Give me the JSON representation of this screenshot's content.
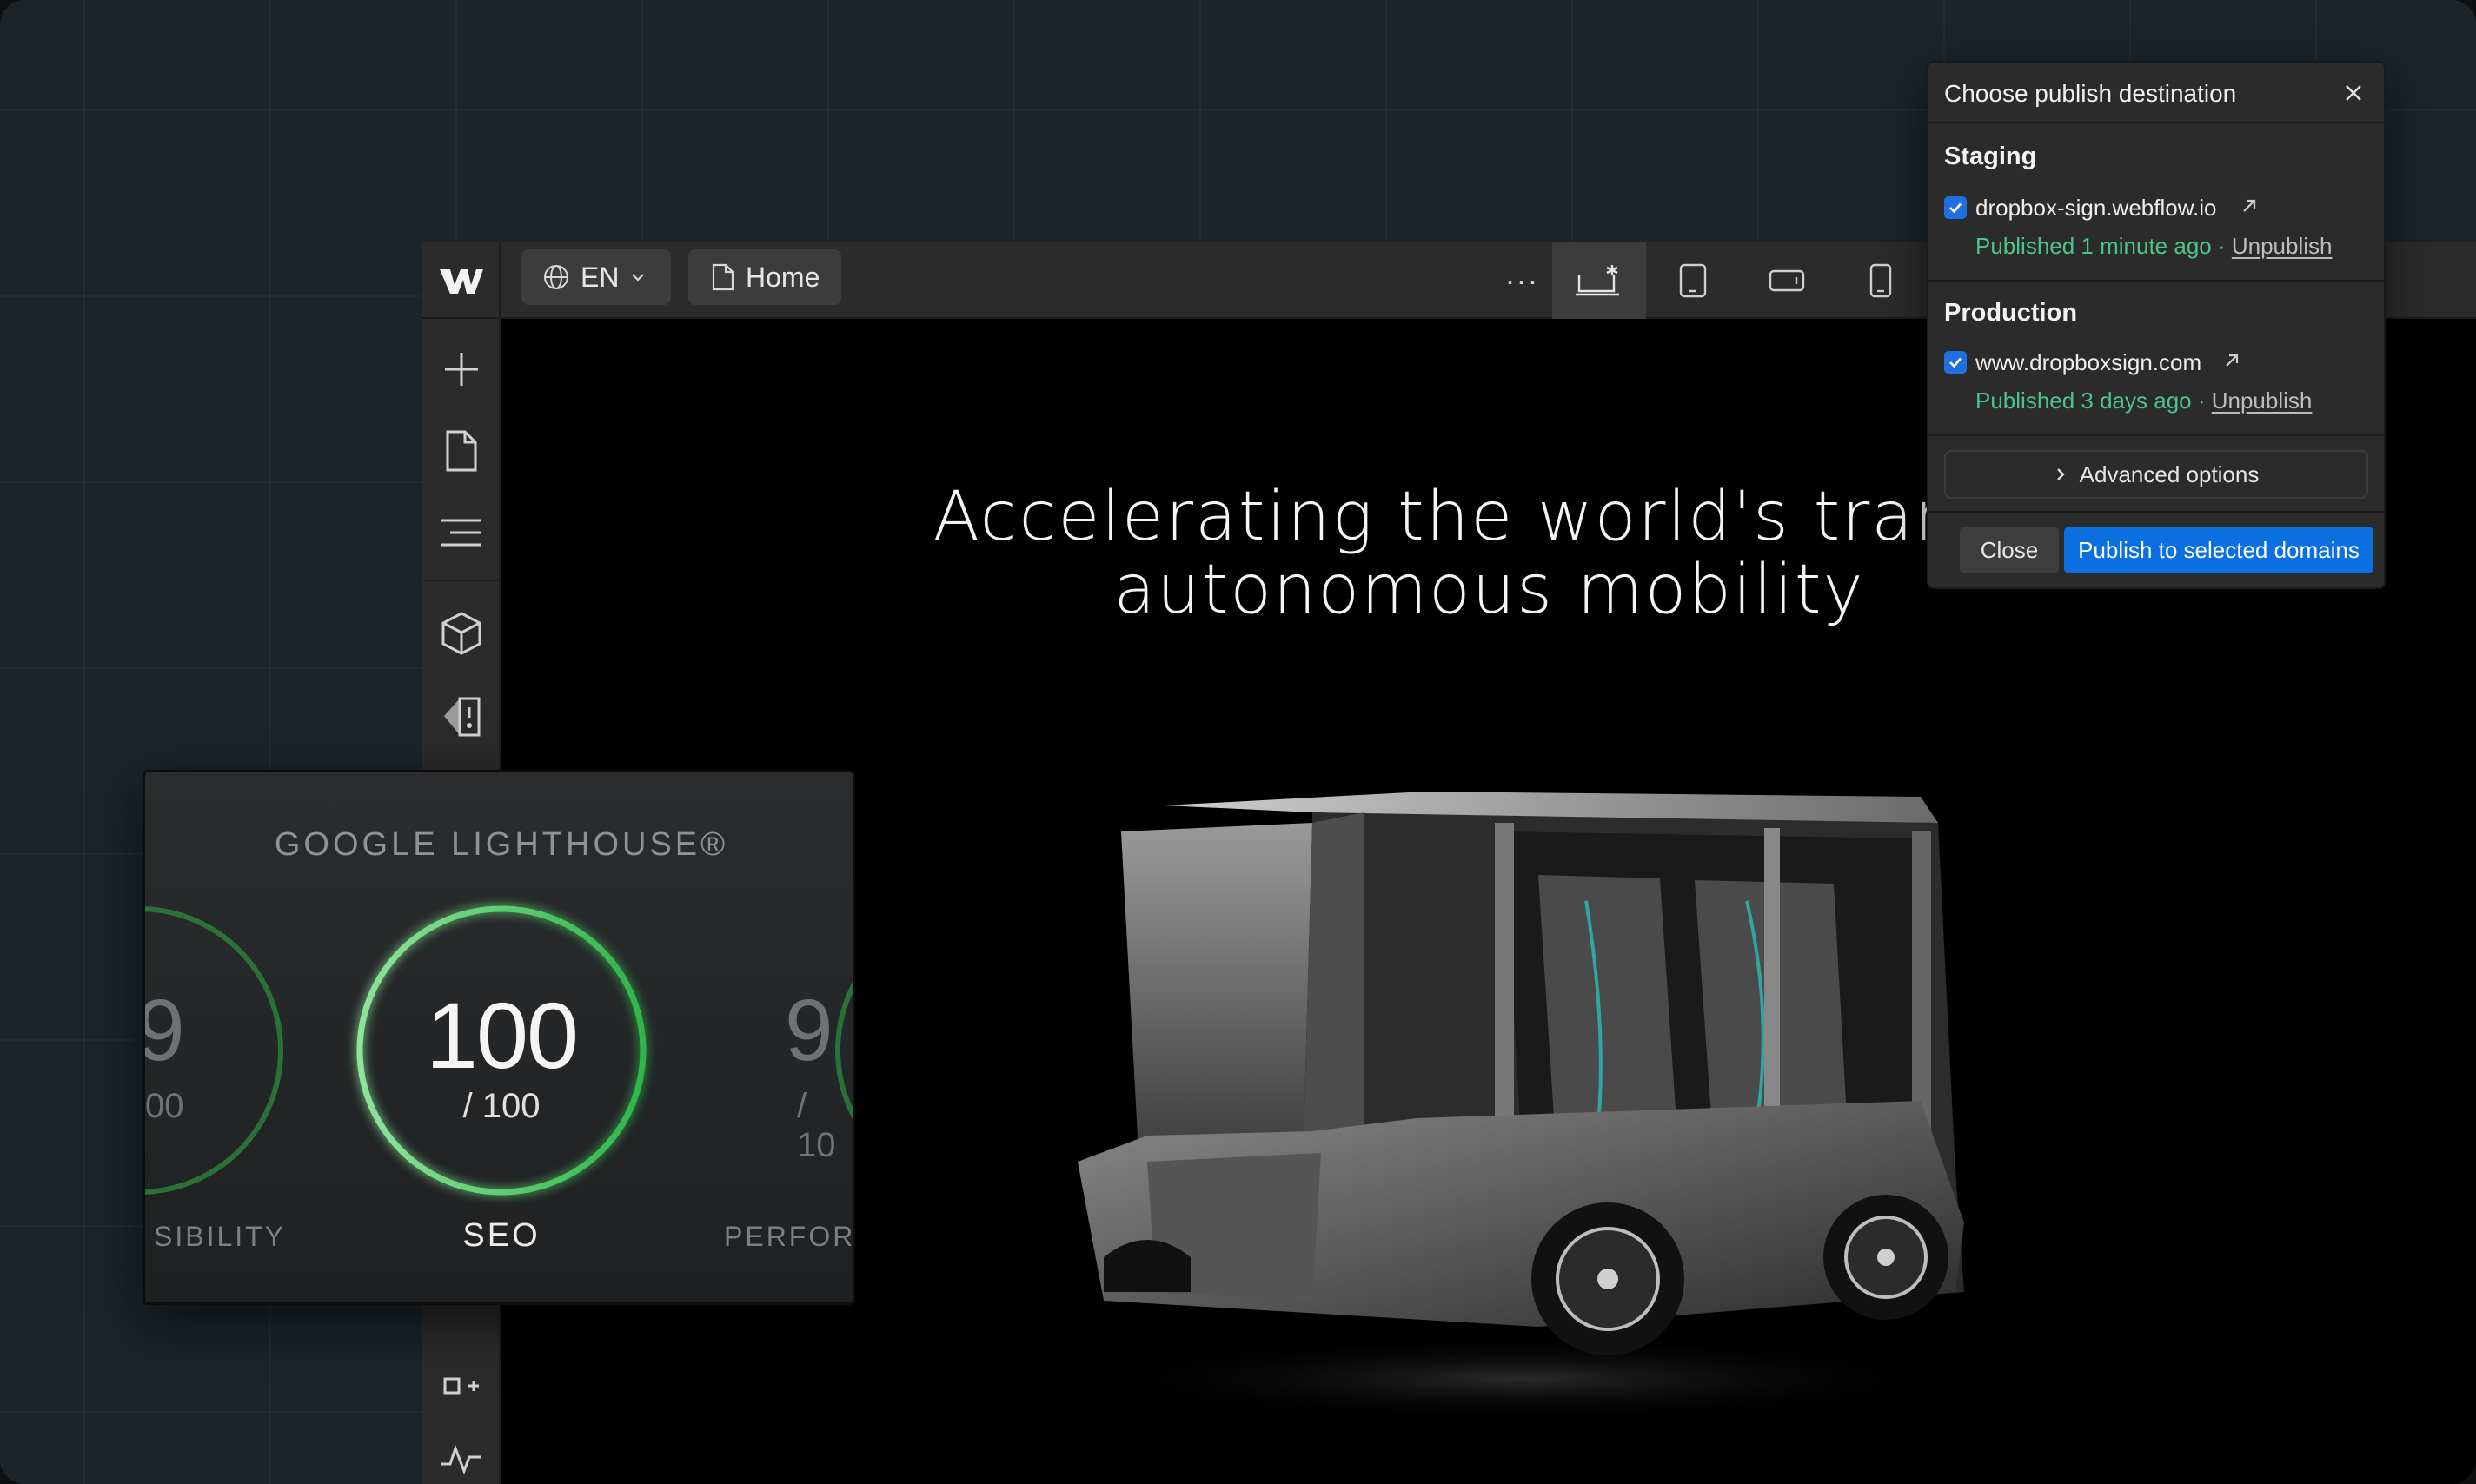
{
  "topbar": {
    "locale_label": "EN",
    "page_label": "Home",
    "more_label": "···"
  },
  "icons": {
    "logo": "webflow-logo-icon",
    "globe": "globe-icon",
    "chevron": "chevron-down-icon",
    "page": "page-icon",
    "desktop": "desktop-breakpoint-icon",
    "tablet": "tablet-icon",
    "landscape": "mobile-landscape-icon",
    "portrait": "mobile-portrait-icon",
    "add": "plus-icon",
    "pages": "pages-icon",
    "navigator": "navigator-icon",
    "components": "cube-icon",
    "styles": "style-manager-icon",
    "add-element": "add-element-icon",
    "activity": "activity-icon"
  },
  "canvas": {
    "hero_line1": "Accelerating the world's transit",
    "hero_line2": "autonomous mobility"
  },
  "lighthouse": {
    "title": "GOOGLE LIGHTHOUSE®",
    "main_score": "100",
    "main_out_of": "/ 100",
    "main_label": "SEO",
    "main_fill": 1.0,
    "left_num": "9",
    "left_sub": "00",
    "left_label": "SIBILITY",
    "right_num": "9",
    "right_sub": "/ 10",
    "right_label": "PERFOR"
  },
  "publish": {
    "title": "Choose publish destination",
    "staging": {
      "title": "Staging",
      "domain": "dropbox-sign.webflow.io",
      "status": "Published 1 minute ago",
      "separator": " · ",
      "unpublish": "Unpublish",
      "checked": true
    },
    "production": {
      "title": "Production",
      "domain": "www.dropboxsign.com",
      "status": "Published 3 days ago",
      "separator": " · ",
      "unpublish": "Unpublish",
      "checked": true
    },
    "advanced_label": "Advanced options",
    "close_label": "Close",
    "publish_label": "Publish to selected domains"
  },
  "colors": {
    "accent_blue": "#0b6fe0",
    "published_green": "#4cc38a",
    "lighthouse_green": "#3fbf5a"
  }
}
